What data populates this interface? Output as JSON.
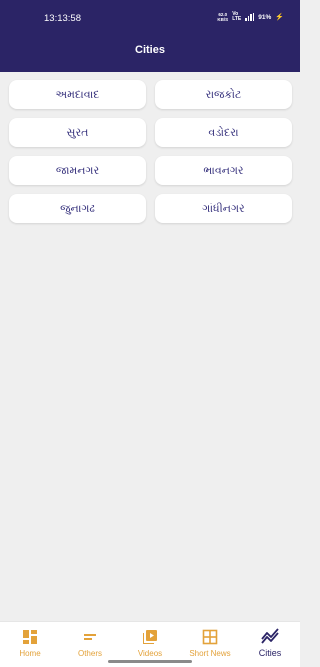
{
  "status_bar": {
    "time": "13:13:58",
    "net_speed_value": "62.0",
    "net_speed_unit": "KB/S",
    "vol_line1": "Vo",
    "vol_line2": "LTE",
    "battery": "91%"
  },
  "header": {
    "title": "Cities",
    "bg_color": "#2b2466"
  },
  "cities": [
    {
      "name": "અમદાવાદ"
    },
    {
      "name": "રાજકોટ"
    },
    {
      "name": "સુરત"
    },
    {
      "name": "વડોદરા"
    },
    {
      "name": "જામનગર"
    },
    {
      "name": "ભાવનગર"
    },
    {
      "name": "જુનાગઢ"
    },
    {
      "name": "ગાંધીનગર"
    }
  ],
  "bottom_nav": {
    "items": [
      {
        "label": "Home",
        "icon": "home-grid-icon"
      },
      {
        "label": "Others",
        "icon": "lines-icon"
      },
      {
        "label": "Videos",
        "icon": "video-library-icon"
      },
      {
        "label": "Short News",
        "icon": "grid-icon"
      },
      {
        "label": "Cities",
        "icon": "trending-icon"
      }
    ],
    "active_index": 4,
    "accent_color": "#e3a23a",
    "active_color": "#2b2466"
  }
}
